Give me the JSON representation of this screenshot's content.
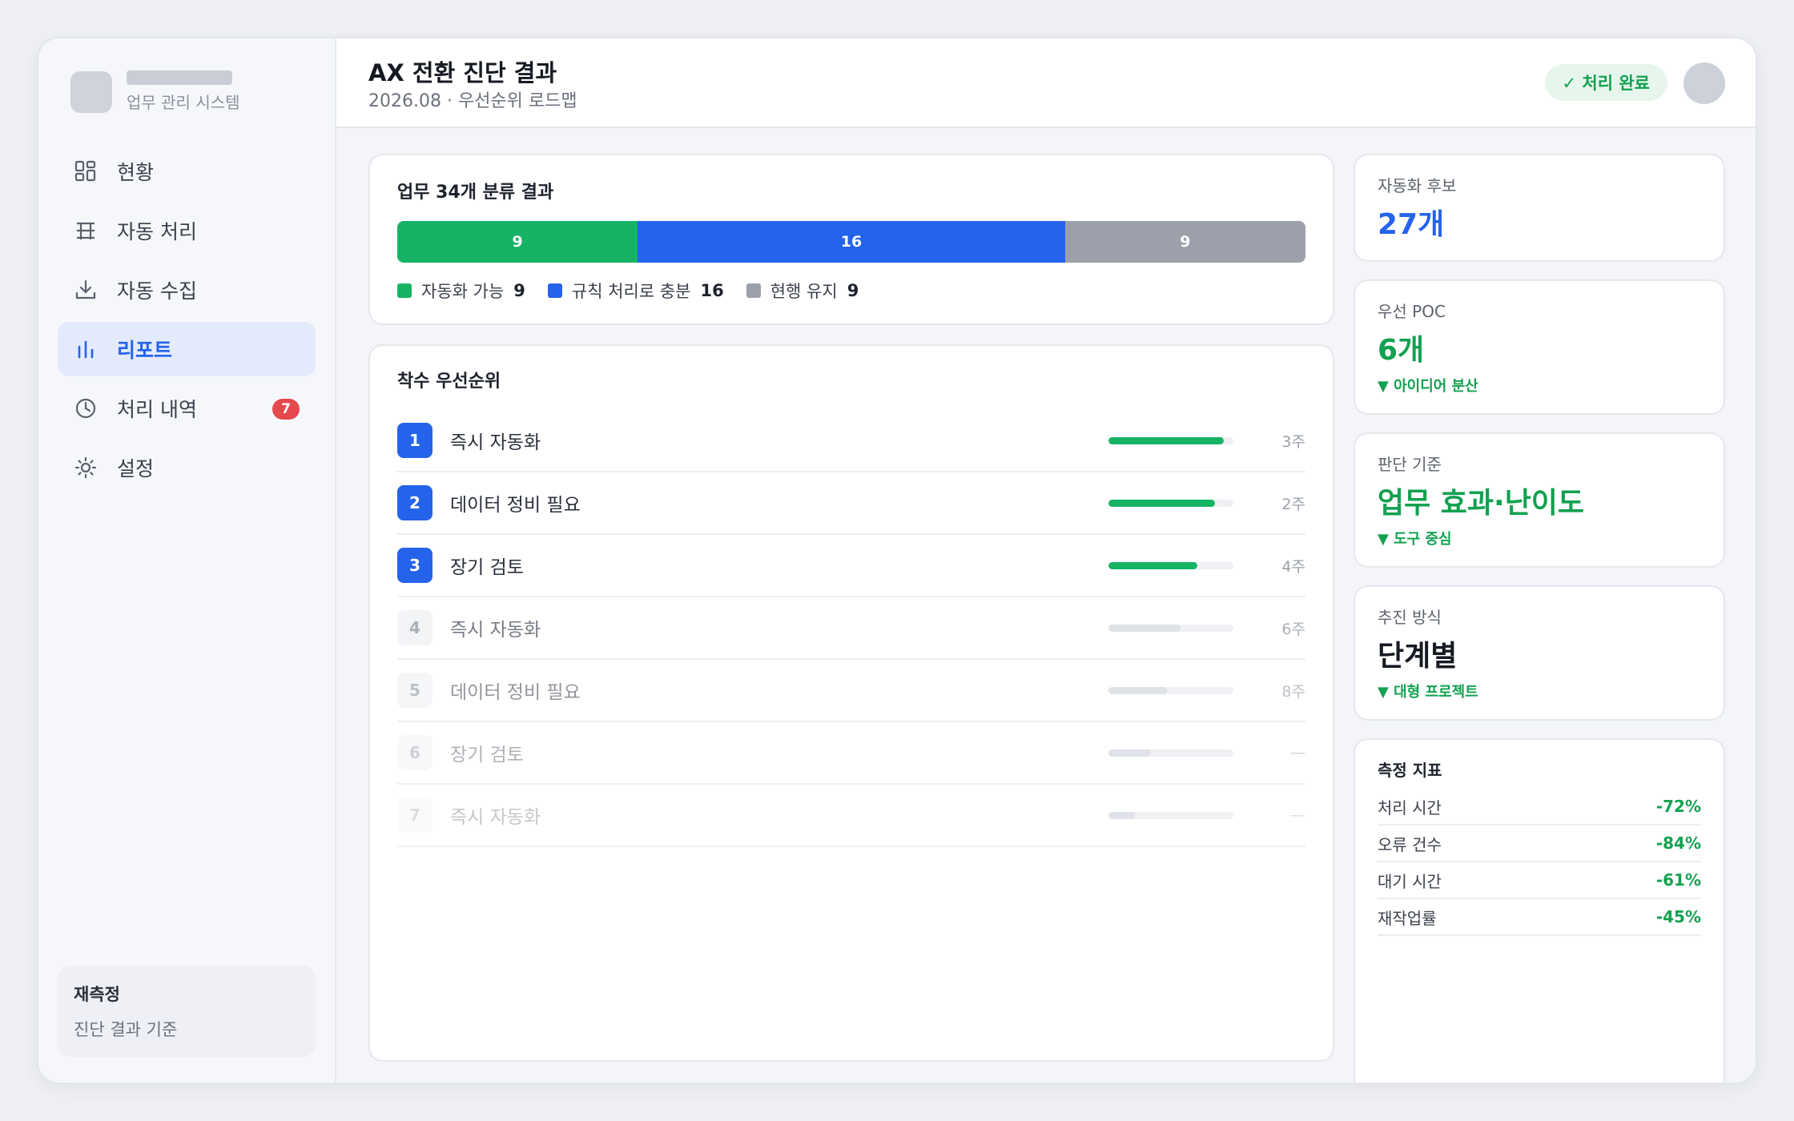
{
  "app": {
    "brand_subtitle": "업무 관리 시스템"
  },
  "sidebar": {
    "items": [
      {
        "label": "현황",
        "icon": "dashboard-icon"
      },
      {
        "label": "자동 처리",
        "icon": "table-icon"
      },
      {
        "label": "자동 수집",
        "icon": "download-icon"
      },
      {
        "label": "리포트",
        "icon": "bar-chart-icon",
        "active": true
      },
      {
        "label": "처리 내역",
        "icon": "clock-icon",
        "badge": "7"
      },
      {
        "label": "설정",
        "icon": "gear-icon"
      }
    ],
    "footer": {
      "title": "재측정",
      "subtitle": "진단 결과 기준"
    }
  },
  "header": {
    "title": "AX 전환 진단 결과",
    "subtitle": "2026.08 · 우선순위 로드맵",
    "status": "✓ 처리 완료"
  },
  "classification": {
    "title": "업무 34개 분류 결과",
    "segments": [
      {
        "label": "자동화 가능",
        "value": 9,
        "color": "#16b364"
      },
      {
        "label": "규칙 처리로 충분",
        "value": 16,
        "color": "#2563eb"
      },
      {
        "label": "현행 유지",
        "value": 9,
        "color": "#9ca0aa"
      }
    ]
  },
  "priority": {
    "title": "착수 우선순위",
    "rows": [
      {
        "rank": "1",
        "label": "즉시 자동화",
        "progress": 0.92,
        "duration": "3주",
        "highlight": true
      },
      {
        "rank": "2",
        "label": "데이터 정비 필요",
        "progress": 0.85,
        "duration": "2주",
        "highlight": true
      },
      {
        "rank": "3",
        "label": "장기 검토",
        "progress": 0.71,
        "duration": "4주",
        "highlight": true
      },
      {
        "rank": "4",
        "label": "즉시 자동화",
        "progress": 0.58,
        "duration": "6주",
        "highlight": false
      },
      {
        "rank": "5",
        "label": "데이터 정비 필요",
        "progress": 0.47,
        "duration": "8주",
        "highlight": false
      },
      {
        "rank": "6",
        "label": "장기 검토",
        "progress": 0.34,
        "duration": "—",
        "highlight": false
      },
      {
        "rank": "7",
        "label": "즉시 자동화",
        "progress": 0.21,
        "duration": "—",
        "highlight": false
      }
    ]
  },
  "kpis": [
    {
      "label": "자동화 후보",
      "value": "27개",
      "color": "#2563eb"
    },
    {
      "label": "우선 POC",
      "value": "6개",
      "color": "#12a150",
      "note": "▼ 아이디어 분산"
    },
    {
      "label": "판단 기준",
      "value": "업무 효과·난이도",
      "color": "#12a150",
      "note": "▼ 도구 중심"
    },
    {
      "label": "추진 방식",
      "value": "단계별",
      "color": "#161a22",
      "note": "▼ 대형 프로젝트"
    }
  ],
  "metrics": {
    "title": "측정 지표",
    "rows": [
      {
        "label": "처리 시간",
        "value": "-72%"
      },
      {
        "label": "오류 건수",
        "value": "-84%"
      },
      {
        "label": "대기 시간",
        "value": "-61%"
      },
      {
        "label": "재작업률",
        "value": "-45%"
      }
    ]
  }
}
